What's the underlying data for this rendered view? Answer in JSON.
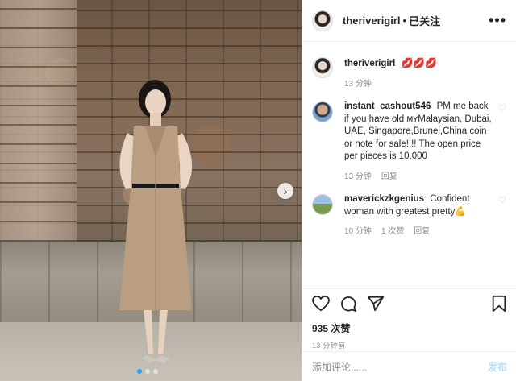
{
  "post": {
    "username": "theriverigirl",
    "follow_separator": "•",
    "follow_status": "已关注",
    "more_icon": "ellipsis-icon"
  },
  "caption": {
    "username": "theriverigirl",
    "text": "💋💋💋",
    "time": "13 分钟"
  },
  "comments": [
    {
      "username": "instant_cashout546",
      "text": "PM me back if you have old ᴍʏMalaysian, Dubai, UAE, Singapore,Brunei,China coin or note for sale!!!! The open price per pieces is 10,000",
      "time": "13 分钟",
      "reply_label": "回复"
    },
    {
      "username": "maverickzkgenius",
      "text": "Confident woman with greatest pretty💪",
      "time": "10 分钟",
      "likes_label": "1 次赞",
      "reply_label": "回复"
    }
  ],
  "actions": {
    "likes": "935 次赞",
    "time": "13 分钟前"
  },
  "add_comment": {
    "placeholder": "添加评论......",
    "post_label": "发布"
  },
  "colors": {
    "accent": "#2b9cf0",
    "post_button": "#b2dffc",
    "muted": "#8e8e8e"
  }
}
